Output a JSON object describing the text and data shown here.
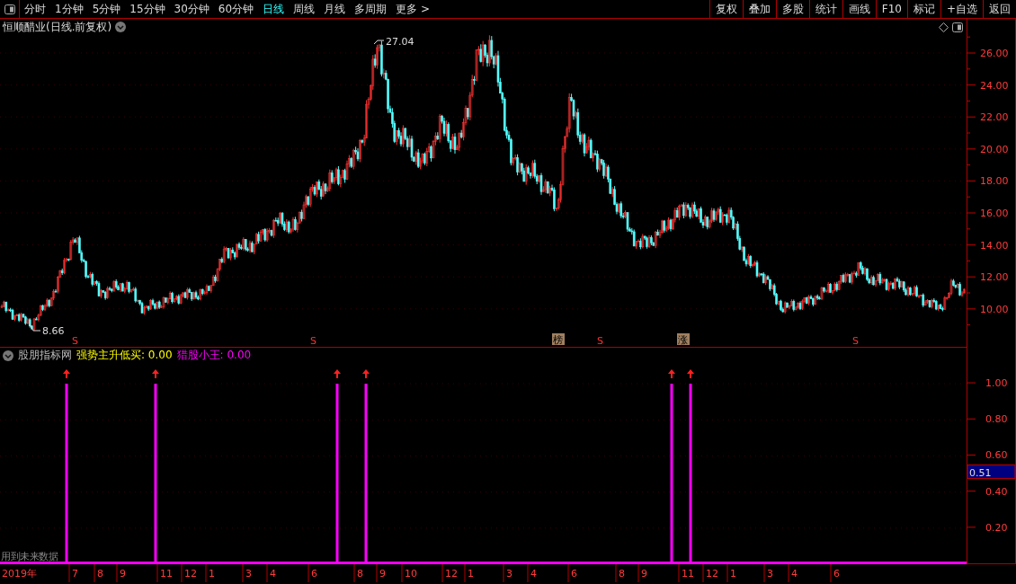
{
  "toolbar": {
    "periods": [
      {
        "label": "分时",
        "selected": false
      },
      {
        "label": "1分钟",
        "selected": false
      },
      {
        "label": "5分钟",
        "selected": false
      },
      {
        "label": "15分钟",
        "selected": false
      },
      {
        "label": "30分钟",
        "selected": false
      },
      {
        "label": "60分钟",
        "selected": false
      },
      {
        "label": "日线",
        "selected": true
      },
      {
        "label": "周线",
        "selected": false
      },
      {
        "label": "月线",
        "selected": false
      },
      {
        "label": "多周期",
        "selected": false
      },
      {
        "label": "更多 >",
        "selected": false
      }
    ],
    "actions": [
      "复权",
      "叠加",
      "多股",
      "统计",
      "画线",
      "F10",
      "标记",
      "+自选",
      "返回"
    ]
  },
  "price_panel": {
    "title": "恒顺醋业(日线.前复权)",
    "axis_ticks": [
      "26.00",
      "24.00",
      "22.00",
      "20.00",
      "18.00",
      "16.00",
      "14.00",
      "12.00",
      "10.00"
    ],
    "high_label": "27.04",
    "low_label": "8.66",
    "markers": [
      {
        "kind": "signal",
        "text": "S"
      },
      {
        "kind": "signal",
        "text": "S"
      },
      {
        "kind": "tag",
        "text": "榜"
      },
      {
        "kind": "signal",
        "text": "S"
      },
      {
        "kind": "tag",
        "text": "涨"
      },
      {
        "kind": "signal",
        "text": "S"
      }
    ]
  },
  "indicator_panel": {
    "source": "股朋指标网",
    "readings": [
      {
        "label": "强势主升低买:",
        "value": "0.00",
        "color": "#ffff00"
      },
      {
        "label": "猎股小王:",
        "value": "0.00",
        "color": "#ff00ff"
      }
    ],
    "cursor_reading": "0.51",
    "note": "用到未来数据",
    "axis_ticks": [
      "1.00",
      "0.80",
      "0.60",
      "0.40",
      "0.20"
    ]
  },
  "time_axis": [
    "2019年",
    "7",
    "8",
    "9",
    "11",
    "12",
    "1",
    "3",
    "4",
    "6",
    "8",
    "9",
    "10",
    "12",
    "1",
    "3",
    "4",
    "6",
    "8",
    "9",
    "11",
    "12",
    "1",
    "3",
    "4",
    "6"
  ]
}
